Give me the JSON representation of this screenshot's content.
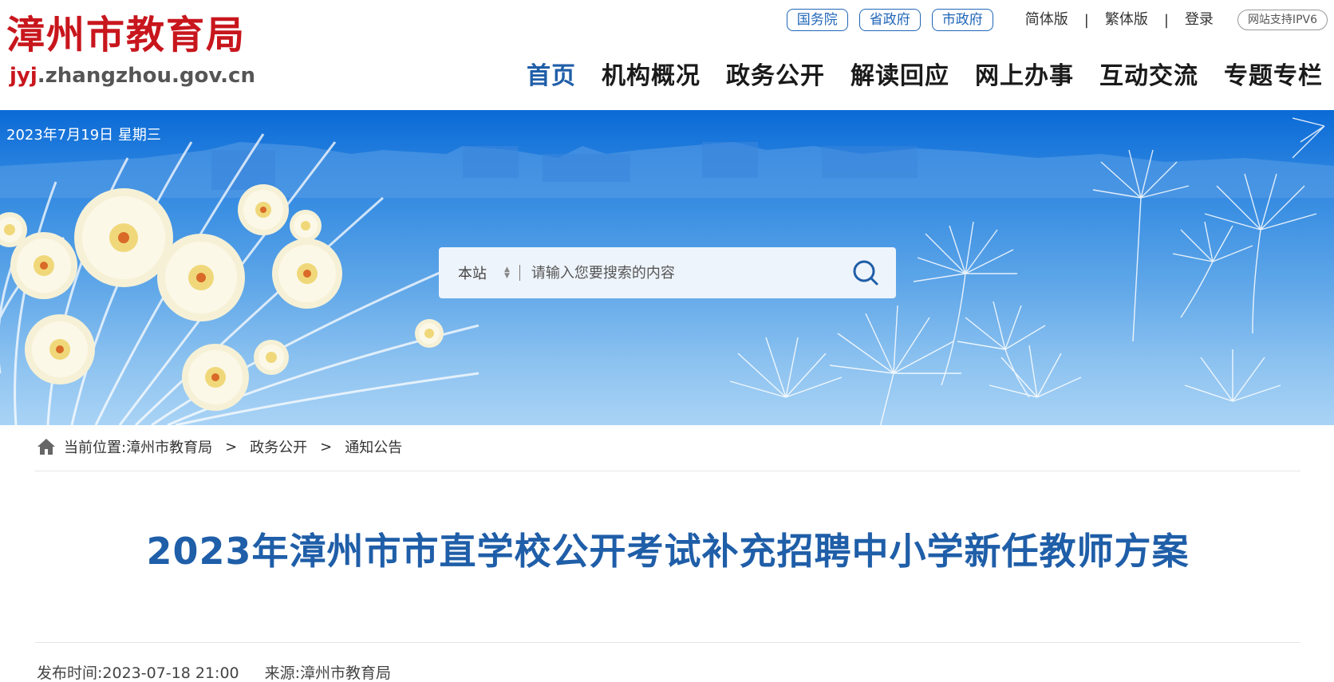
{
  "header": {
    "logo_cn": "漳州市教育局",
    "logo_url_prefix": "jyj",
    "logo_url_rest": ".zhangzhou.gov.cn",
    "gov_links": [
      "国务院",
      "省政府",
      "市政府"
    ],
    "simplified": "简体版",
    "traditional": "繁体版",
    "login": "登录",
    "ipv6": "网站支持IPV6",
    "nav": [
      "首页",
      "机构概况",
      "政务公开",
      "解读回应",
      "网上办事",
      "互动交流",
      "专题专栏"
    ]
  },
  "banner": {
    "date": "2023年7月19日 星期三",
    "search_scope": "本站",
    "search_placeholder": "请输入您要搜索的内容"
  },
  "breadcrumb": {
    "label": "当前位置:",
    "items": [
      "漳州市教育局",
      "政务公开",
      "通知公告"
    ],
    "sep": ">"
  },
  "article": {
    "title": "2023年漳州市市直学校公开考试补充招聘中小学新任教师方案",
    "publish_label": "发布时间:",
    "publish_time": "2023-07-18 21:00",
    "source_label": "来源:",
    "source": "漳州市教育局"
  },
  "colors": {
    "brand_red": "#c8161d",
    "nav_blue": "#1f5ea8",
    "banner_blue": "#0b6ad6"
  }
}
